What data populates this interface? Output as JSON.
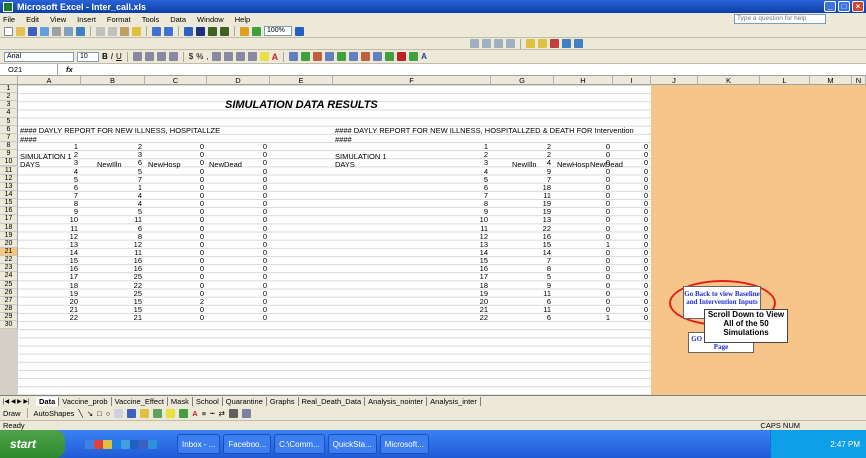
{
  "window": {
    "title": "Microsoft Excel - Inter_call.xls"
  },
  "menu": [
    "File",
    "Edit",
    "View",
    "Insert",
    "Format",
    "Tools",
    "Data",
    "Window",
    "Help"
  ],
  "help_placeholder": "Type a question for help",
  "toolbar": {
    "zoom": "100%",
    "font": "Arial",
    "size": "10"
  },
  "formula_bar": {
    "cell_ref": "O21",
    "fx": "fx"
  },
  "columns": [
    "A",
    "B",
    "C",
    "D",
    "E",
    "F",
    "G",
    "H",
    "I",
    "J",
    "K",
    "L",
    "M",
    "N"
  ],
  "rows": [
    "1",
    "2",
    "3",
    "4",
    "5",
    "6",
    "7",
    "8",
    "9",
    "10",
    "11",
    "12",
    "13",
    "14",
    "15",
    "16",
    "17",
    "18",
    "19",
    "20",
    "21",
    "22",
    "23",
    "24",
    "25",
    "26",
    "27",
    "28",
    "29",
    "30"
  ],
  "sheet": {
    "title": "SIMULATION DATA RESULTS",
    "left_report": "#### DAYLY REPORT FOR NEW ILLNESS, HOSPITALLZE",
    "right_report": "#### DAYLY REPORT FOR NEW ILLNESS, HOSPITALLZED & DEATH FOR Intervention",
    "hash": "####",
    "sim_label": "SIMULATION 1",
    "headers": [
      "DAYS",
      "NewIlln",
      "NewHosp",
      "NewDead"
    ],
    "left_data": [
      [
        1,
        2,
        0,
        0
      ],
      [
        2,
        3,
        0,
        0
      ],
      [
        3,
        6,
        0,
        0
      ],
      [
        4,
        5,
        0,
        0
      ],
      [
        5,
        7,
        0,
        0
      ],
      [
        6,
        1,
        0,
        0
      ],
      [
        7,
        4,
        0,
        0
      ],
      [
        8,
        4,
        0,
        0
      ],
      [
        9,
        5,
        0,
        0
      ],
      [
        10,
        11,
        0,
        0
      ],
      [
        11,
        6,
        0,
        0
      ],
      [
        12,
        8,
        0,
        0
      ],
      [
        13,
        12,
        0,
        0
      ],
      [
        14,
        11,
        0,
        0
      ],
      [
        15,
        16,
        0,
        0
      ],
      [
        16,
        16,
        0,
        0
      ],
      [
        17,
        25,
        0,
        0
      ],
      [
        18,
        22,
        0,
        0
      ],
      [
        19,
        25,
        0,
        0
      ],
      [
        20,
        15,
        2,
        0
      ],
      [
        21,
        15,
        0,
        0
      ],
      [
        22,
        21,
        0,
        0
      ]
    ],
    "right_data": [
      [
        1,
        2,
        0,
        0
      ],
      [
        2,
        2,
        0,
        0
      ],
      [
        3,
        4,
        0,
        0
      ],
      [
        4,
        9,
        0,
        0
      ],
      [
        5,
        7,
        0,
        0
      ],
      [
        6,
        18,
        0,
        0
      ],
      [
        7,
        11,
        0,
        0
      ],
      [
        8,
        19,
        0,
        0
      ],
      [
        9,
        19,
        0,
        0
      ],
      [
        10,
        13,
        0,
        0
      ],
      [
        11,
        22,
        0,
        0
      ],
      [
        12,
        16,
        0,
        0
      ],
      [
        13,
        15,
        1,
        0
      ],
      [
        14,
        14,
        0,
        0
      ],
      [
        15,
        7,
        0,
        0
      ],
      [
        16,
        8,
        0,
        0
      ],
      [
        17,
        5,
        0,
        0
      ],
      [
        18,
        9,
        0,
        0
      ],
      [
        19,
        11,
        0,
        0
      ],
      [
        20,
        6,
        0,
        0
      ],
      [
        21,
        11,
        0,
        0
      ],
      [
        22,
        6,
        1,
        0
      ]
    ]
  },
  "buttons": {
    "baseline": "Go Back to view Baseline and Intervention Inputs",
    "main_results": "GO to Main Results Page",
    "scroll_note": "Scroll Down to View All of the 50 Simulations"
  },
  "tabs": [
    "Data",
    "Vaccine_prob",
    "Vaccine_Effect",
    "Mask",
    "School",
    "Quarantine",
    "Graphs",
    "Real_Death_Data",
    "Analysis_nointer",
    "Analysis_inter"
  ],
  "active_tab": "Data",
  "drawbar": {
    "draw": "Draw",
    "autoshapes": "AutoShapes"
  },
  "status": {
    "ready": "Ready",
    "caps": "CAPS NUM"
  },
  "taskbar": {
    "start": "start",
    "tasks": [
      "Inbox - ...",
      "Faceboo...",
      "C:\\Comm...",
      "QuickSta...",
      "Microsoft..."
    ],
    "clock": "2:47 PM"
  },
  "colors": {
    "accent_orange": "#f7c48a",
    "button_text": "#1f2fd0",
    "highlight_ellipse": "#e0201c"
  }
}
